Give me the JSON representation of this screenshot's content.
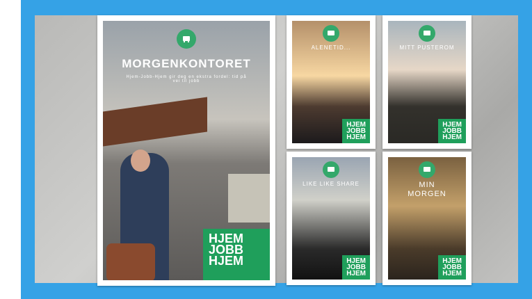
{
  "posters": {
    "main": {
      "title": "MORGENKONTORET",
      "text": "Hjem-Jobb-Hjem gir deg en ekstra fordel: tid på vei til jobb",
      "brand": [
        "HJEM",
        "JOBB",
        "HJEM"
      ]
    },
    "p1": {
      "title": "ALENETID...",
      "brand": [
        "HJEM",
        "JOBB",
        "HJEM"
      ]
    },
    "p2": {
      "title": "MITT PUSTEROM",
      "brand": [
        "HJEM",
        "JOBB",
        "HJEM"
      ]
    },
    "p3": {
      "title": "LIKE LIKE SHARE",
      "brand": [
        "HJEM",
        "JOBB",
        "HJEM"
      ]
    },
    "p4": {
      "title": [
        "MIN",
        "MORGEN"
      ],
      "brand": [
        "HJEM",
        "JOBB",
        "HJEM"
      ]
    }
  },
  "colors": {
    "frame": "#35a2e6",
    "green": "#1f9f5b"
  }
}
